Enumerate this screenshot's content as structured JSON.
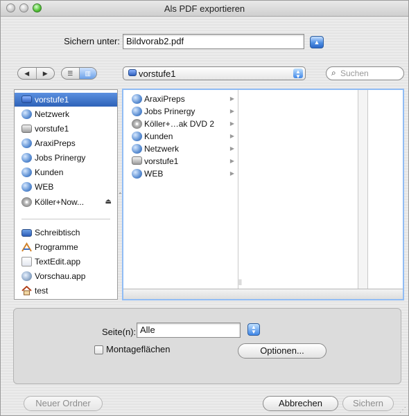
{
  "window": {
    "title": "Als PDF exportieren"
  },
  "save": {
    "label": "Sichern unter:",
    "filename": "Bildvorab2.pdf"
  },
  "toolbar": {
    "location": "vorstufe1",
    "search_placeholder": "Suchen"
  },
  "sidebar": {
    "devices": [
      {
        "label": "vorstufe1",
        "icon": "monitor-icon",
        "selected": true
      },
      {
        "label": "Netzwerk",
        "icon": "network-globe-icon"
      },
      {
        "label": "vorstufe1",
        "icon": "hard-disk-icon"
      },
      {
        "label": "AraxiPreps",
        "icon": "network-globe-icon"
      },
      {
        "label": "Jobs Prinergy",
        "icon": "network-globe-icon"
      },
      {
        "label": "Kunden",
        "icon": "network-globe-icon"
      },
      {
        "label": "WEB",
        "icon": "network-globe-icon"
      },
      {
        "label": "Köller+Now...",
        "icon": "dvd-icon",
        "eject": "⏏"
      }
    ],
    "places": [
      {
        "label": "Schreibtisch",
        "icon": "desktop-icon"
      },
      {
        "label": "Programme",
        "icon": "applications-icon"
      },
      {
        "label": "TextEdit.app",
        "icon": "textedit-icon"
      },
      {
        "label": "Vorschau.app",
        "icon": "preview-icon"
      },
      {
        "label": "test",
        "icon": "home-icon"
      }
    ]
  },
  "browser": {
    "column1": [
      {
        "label": "AraxiPreps",
        "icon": "network-globe-icon"
      },
      {
        "label": "Jobs Prinergy",
        "icon": "network-globe-icon"
      },
      {
        "label": "Köller+…ak DVD 2",
        "icon": "dvd-icon"
      },
      {
        "label": "Kunden",
        "icon": "network-globe-icon"
      },
      {
        "label": "Netzwerk",
        "icon": "network-globe-icon"
      },
      {
        "label": "vorstufe1",
        "icon": "hard-disk-icon"
      },
      {
        "label": "WEB",
        "icon": "network-globe-icon"
      }
    ]
  },
  "options": {
    "pages_label": "Seite(n):",
    "pages_value": "Alle",
    "montage_label": "Montageflächen",
    "montage_checked": false,
    "options_button": "Optionen..."
  },
  "footer": {
    "new_folder": "Neuer Ordner",
    "cancel": "Abbrechen",
    "save": "Sichern"
  }
}
